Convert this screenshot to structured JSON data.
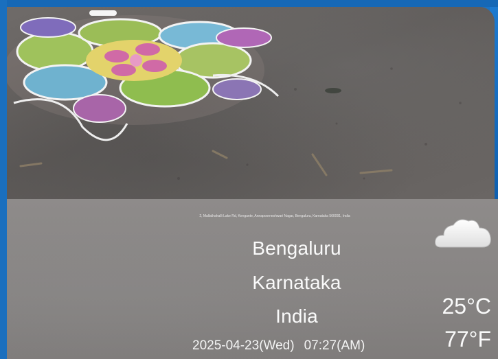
{
  "location": {
    "address": "2, Mallathahalli Lake Rd, Kengunte, Annapoorneshwari Nagar, Bengaluru, Karnataka 560091, India",
    "city": "Bengaluru",
    "state": "Karnataka",
    "country": "India"
  },
  "datetime": {
    "date": "2025-04-23(Wed)",
    "time": "07:27(AM)"
  },
  "weather": {
    "icon": "cloud-icon",
    "temp_c": "25°C",
    "temp_f": "77°F"
  },
  "colors": {
    "frame": "#1b73c4",
    "panel": "#8a8786",
    "text": "#fafafa"
  }
}
